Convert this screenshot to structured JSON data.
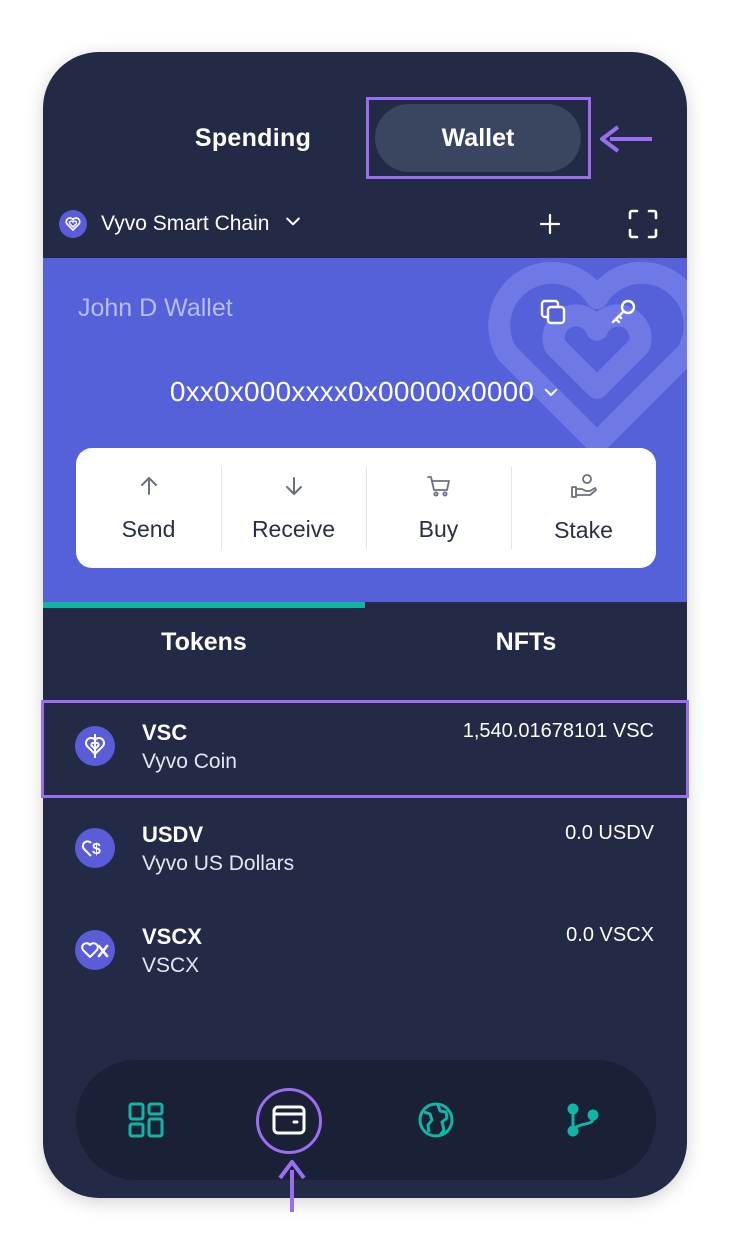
{
  "toggle": {
    "spending_label": "Spending",
    "wallet_label": "Wallet",
    "active": "Wallet"
  },
  "chain": {
    "name": "Vyvo Smart Chain",
    "icon": "heart-logo-icon"
  },
  "header_actions": [
    {
      "icon": "plus-icon"
    },
    {
      "icon": "scan-frame-icon"
    }
  ],
  "wallet": {
    "name": "John D Wallet",
    "address": "0xx0x000xxxx0x00000x0000",
    "card_icons": [
      "copy-icon",
      "key-icon"
    ]
  },
  "actions": [
    {
      "label": "Send",
      "icon": "arrow-up-icon"
    },
    {
      "label": "Receive",
      "icon": "arrow-down-icon"
    },
    {
      "label": "Buy",
      "icon": "cart-icon"
    },
    {
      "label": "Stake",
      "icon": "hand-coin-icon"
    }
  ],
  "tabs": [
    {
      "label": "Tokens",
      "active": true
    },
    {
      "label": "NFTs",
      "active": false
    }
  ],
  "tokens": [
    {
      "symbol": "VSC",
      "name": "Vyvo Coin",
      "balance": "1,540.01678101 VSC",
      "highlighted": true
    },
    {
      "symbol": "USDV",
      "name": "Vyvo US Dollars",
      "balance": "0.0 USDV",
      "highlighted": false
    },
    {
      "symbol": "VSCX",
      "name": "VSCX",
      "balance": "0.0 VSCX",
      "highlighted": false
    }
  ],
  "bottom_nav": [
    {
      "icon": "dashboard-grid-icon",
      "active": false
    },
    {
      "icon": "wallet-icon",
      "active": true
    },
    {
      "icon": "globe-icon",
      "active": false
    },
    {
      "icon": "branch-icon",
      "active": false
    }
  ],
  "colors": {
    "background": "#222a45",
    "wallet_card": "#5561d8",
    "accent_teal": "#12b5a3",
    "highlight_purple": "#9a6ef0"
  }
}
